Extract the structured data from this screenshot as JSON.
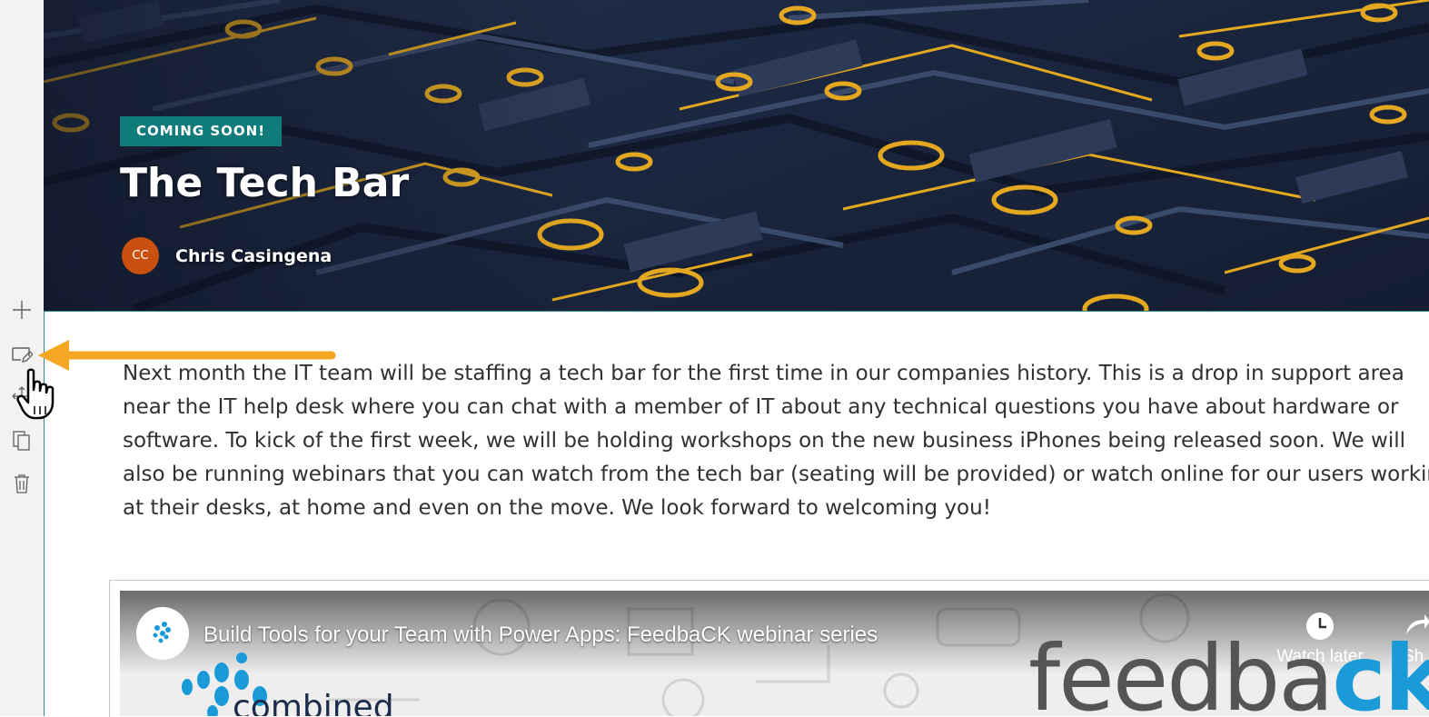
{
  "toolbar": {
    "items": [
      {
        "icon": "add-icon"
      },
      {
        "icon": "edit-web-part-icon"
      },
      {
        "icon": "move-icon"
      },
      {
        "icon": "duplicate-icon"
      },
      {
        "icon": "delete-icon"
      }
    ]
  },
  "hero": {
    "badge": "COMING SOON!",
    "title": "The Tech Bar",
    "author_initials": "CC",
    "author_name": "Chris Casingena",
    "avatar_color": "#ca5010",
    "badge_color": "#0f7b7b"
  },
  "body": {
    "lines": [
      "Next month the IT team will be staffing a tech bar for the first time in our companies history. This is a drop in support area",
      "near the IT help desk where you can chat with a member of IT about any technical questions you have about hardware or",
      "software. To kick of the first week, we will be holding workshops on the new business iPhones being released soon. We will",
      "also be running webinars that you can watch from the tech bar (seating will be provided) or watch online for our users working",
      "at their desks, at home and even on the move. We look forward to welcoming you!"
    ]
  },
  "video": {
    "title": "Build Tools for your Team with Power Apps: FeedbaCK webinar series",
    "watch_later": "Watch later",
    "share": "Sh",
    "brand_main": "feedba",
    "brand_accent": "ck",
    "logo_text": "combined"
  },
  "annotation": {
    "arrow_color": "#f5a623"
  }
}
